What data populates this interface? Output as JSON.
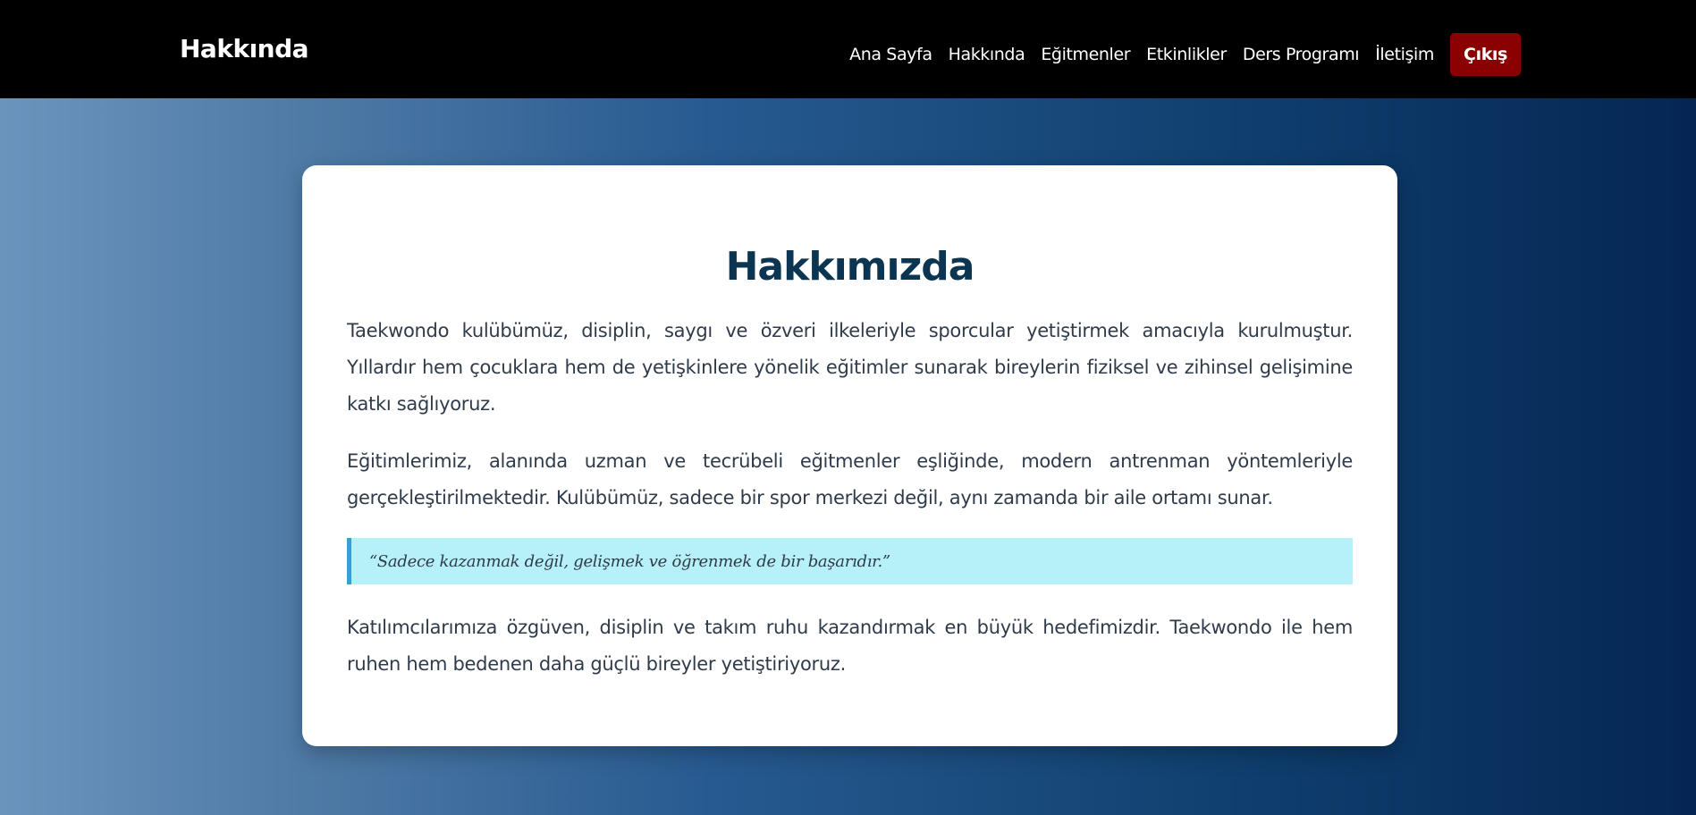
{
  "header": {
    "brand": "Hakkında",
    "nav": [
      "Ana Sayfa",
      "Hakkında",
      "Eğitmenler",
      "Etkinlikler",
      "Ders Programı",
      "İletişim"
    ],
    "logout_label": "Çıkış"
  },
  "main": {
    "title": "Hakkımızda",
    "paragraph1": "Taekwondo kulübümüz, disiplin, saygı ve özveri ilkeleriyle sporcular yetiştirmek amacıyla kurulmuştur. Yıllardır hem çocuklara hem de yetişkinlere yönelik eğitimler sunarak bireylerin fiziksel ve zihinsel gelişimine katkı sağlıyoruz.",
    "paragraph2": "Eğitimlerimiz, alanında uzman ve tecrübeli eğitmenler eşliğinde, modern antrenman yöntemleriyle gerçekleştirilmektedir. Kulübümüz, sadece bir spor merkezi değil, aynı zamanda bir aile ortamı sunar.",
    "quote": "“Sadece kazanmak değil, gelişmek ve öğrenmek de bir başarıdır.”",
    "paragraph3": "Katılımcılarımıza özgüven, disiplin ve takım ruhu kazandırmak en büyük hedefimizdir. Taekwondo ile hem ruhen hem bedenen daha güçlü bireyler yetiştiriyoruz."
  },
  "colors": {
    "navbar_bg": "#000000",
    "logout_bg": "#8b0000",
    "title": "#0b3550",
    "quote_bg": "#b6f0f8",
    "quote_border": "#3a9ed6"
  }
}
